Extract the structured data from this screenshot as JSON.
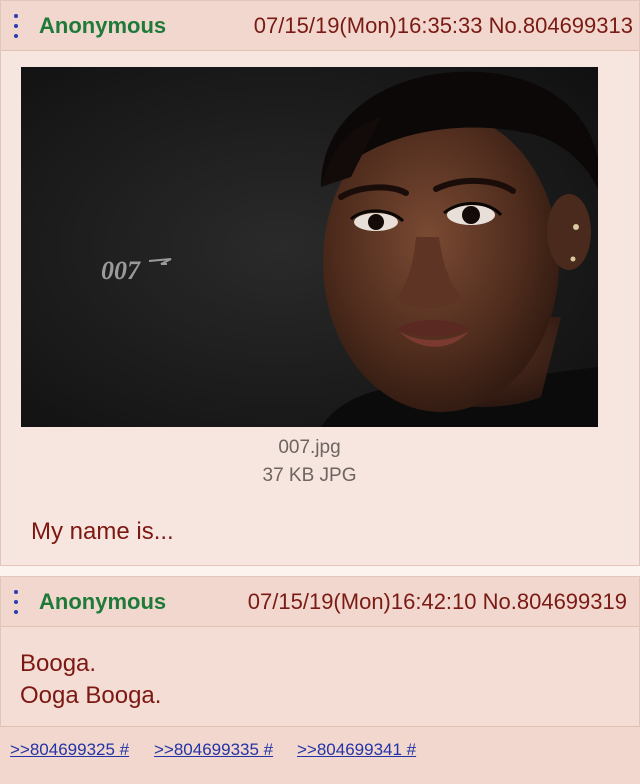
{
  "posts": [
    {
      "name": "Anonymous",
      "datetime": "07/15/19(Mon)16:35:33 No.804699313",
      "file": {
        "name": "007.jpg",
        "info": "37 KB JPG",
        "logo_text": "007"
      },
      "comment": [
        "My name is..."
      ]
    },
    {
      "name": "Anonymous",
      "datetime": "07/15/19(Mon)16:42:10 No.804699319",
      "comment": [
        "Booga.",
        "Ooga Booga."
      ],
      "replies": [
        ">>804699325 #",
        ">>804699335 #",
        ">>804699341 #"
      ]
    }
  ],
  "colors": {
    "name": "#1f7a3a",
    "datetime": "#7a1a14",
    "comment": "#7d1711",
    "link": "#2434a6",
    "menu_dots": "#2b3bb0"
  }
}
